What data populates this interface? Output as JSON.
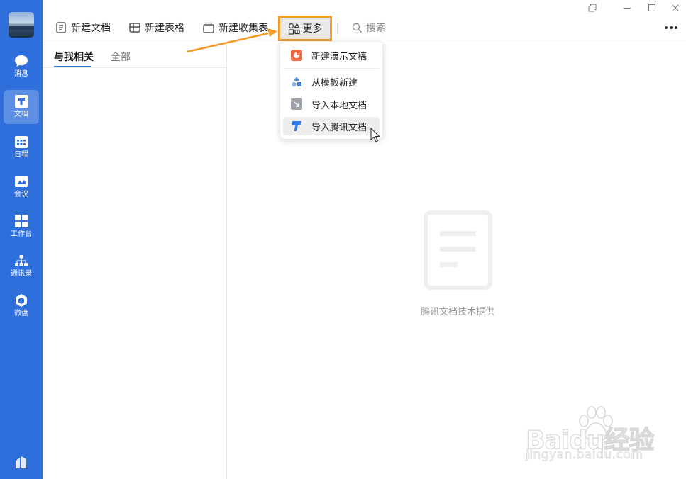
{
  "sidebar": {
    "items": [
      {
        "label": "消息",
        "icon": "chat-bubble-icon"
      },
      {
        "label": "文档",
        "icon": "doc-icon"
      },
      {
        "label": "日程",
        "icon": "calendar-icon"
      },
      {
        "label": "会议",
        "icon": "meeting-icon"
      },
      {
        "label": "工作台",
        "icon": "grid-icon"
      },
      {
        "label": "通讯录",
        "icon": "org-chart-icon"
      },
      {
        "label": "微盘",
        "icon": "drive-icon"
      }
    ],
    "active_item": "文档",
    "accent": "#2f6fdc"
  },
  "toolbar": {
    "new_doc": "新建文档",
    "new_sheet": "新建表格",
    "new_form": "新建收集表",
    "more": "更多",
    "search_placeholder": "搜索"
  },
  "tabs": {
    "related": "与我相关",
    "all": "全部"
  },
  "dropdown": {
    "items": [
      {
        "label": "新建演示文稿",
        "icon": "slides-icon"
      },
      {
        "label": "从模板新建",
        "icon": "template-shapes-icon"
      },
      {
        "label": "导入本地文档",
        "icon": "import-local-icon"
      },
      {
        "label": "导入腾讯文档",
        "icon": "tencent-docs-icon"
      }
    ],
    "hovered_item": "导入腾讯文档"
  },
  "empty_state": {
    "text": "腾讯文档技术提供"
  },
  "watermark": {
    "logo": "Baidu经验",
    "url": "jingyan.baidu.com"
  },
  "highlight_color": "#f39a27"
}
